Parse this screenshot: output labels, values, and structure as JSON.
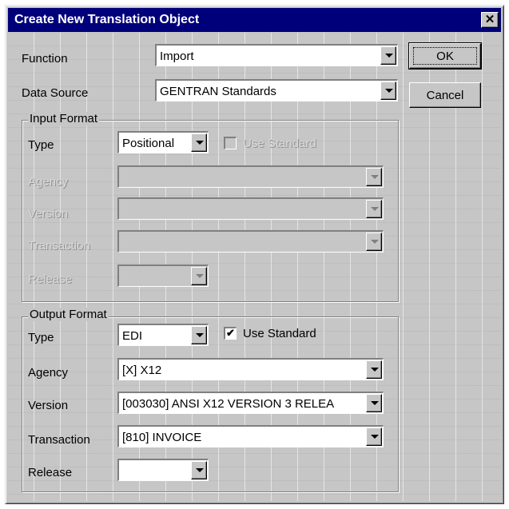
{
  "window": {
    "title": "Create New Translation Object",
    "close_glyph": "✕"
  },
  "buttons": {
    "ok": "OK",
    "cancel": "Cancel"
  },
  "function": {
    "label": "Function",
    "value": "Import"
  },
  "data_source": {
    "label": "Data Source",
    "value": "GENTRAN Standards"
  },
  "input_format": {
    "legend": "Input Format",
    "type_label": "Type",
    "type_value": "Positional",
    "use_standard_label": "Use Standard",
    "use_standard_checked": false,
    "agency_label": "Agency",
    "agency_value": "",
    "version_label": "Version",
    "version_value": "",
    "transaction_label": "Transaction",
    "transaction_value": "",
    "release_label": "Release",
    "release_value": ""
  },
  "output_format": {
    "legend": "Output Format",
    "type_label": "Type",
    "type_value": "EDI",
    "use_standard_label": "Use Standard",
    "use_standard_checked": true,
    "check_glyph": "✔",
    "agency_label": "Agency",
    "agency_value": "[X] X12",
    "version_label": "Version",
    "version_value": "[003030] ANSI X12 VERSION 3 RELEA",
    "transaction_label": "Transaction",
    "transaction_value": "[810] INVOICE",
    "release_label": "Release",
    "release_value": ""
  },
  "colors": {
    "titlebar": "#00007b",
    "face": "#c6c6c6"
  }
}
